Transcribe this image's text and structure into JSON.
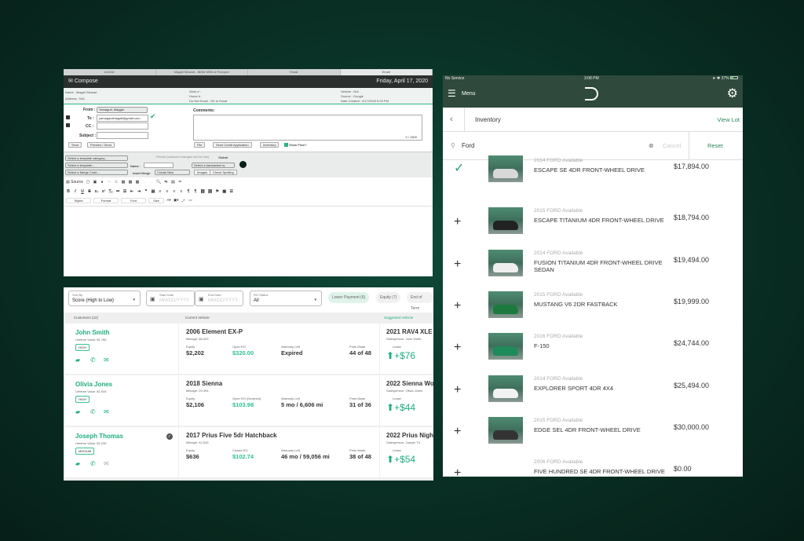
{
  "compose": {
    "tabs": [
      "eLEAD",
      "Magali Stewart - BMW MINI of Freeport",
      "Email",
      "Email"
    ],
    "title": "Compose",
    "date": "Friday, April 17, 2020",
    "info": {
      "name": "Name : Magali Stewart",
      "address": "Address : N/A",
      "work": "Work # :",
      "home": "Home # :",
      "do_not_email": "Do Not Email : OK to Email",
      "vehicle": "Vehicle : N/A",
      "source": "Source : Google",
      "date_created": "Date Created : 4/17/2020 5:29 PM"
    },
    "from_label": "From :",
    "from_value": "Yamaguti, Maggie",
    "to_label": "To :",
    "to_value": "yamagautimagali@gmail.com",
    "cc_label": "CC :",
    "subject_label": "Subject :",
    "comments_label": "Comments:",
    "char_count": "0 / 1500",
    "buttons": {
      "send": "Send",
      "preview": "Preview / Send",
      "file": "File",
      "credit": "Send Credit Application",
      "inventory": "Inventory",
      "show_price": "Show Price?"
    },
    "template": {
      "category": "Select a template category...",
      "template": "Select a template...",
      "merge": "Select a Merge Code...",
      "persist": "Persist (unsaved changes will be lost)",
      "global": "Global:",
      "name_label": "Name :",
      "transaction": "Select a transaction ty",
      "insert_merge": "Insert Merge",
      "create_new": "Create New",
      "images": "Images",
      "check_spelling": "Check Spelling"
    },
    "editor": {
      "source": "Source",
      "styles": "Styles",
      "format": "Format",
      "font": "Font",
      "size": "Size"
    }
  },
  "crm": {
    "sort_label": "Sort By",
    "sort_value": "Score (High to Low)",
    "start_label": "Start Date",
    "start_ph": "MM/DD/YYYY",
    "end_label": "End Date",
    "end_ph": "MM/DD/YYYY",
    "ro_label": "RO Status",
    "ro_value": "All",
    "chips": [
      "Lower Payment (6)",
      "Equity (7)",
      "End of Term"
    ],
    "col_customers": "Customers (22)",
    "col_vehicle": "Current Vehicle",
    "col_suggested": "Suggested Vehicle",
    "rows": [
      {
        "name": "John Smith",
        "lifetime": "Lifetime Value: $1,766",
        "badge": "HIGH",
        "vehicle": "2006 Element EX-P",
        "mileage": "Mileage: 86,023",
        "equity_label": "Equity",
        "equity": "$2,202",
        "ro_label": "Open RO",
        "ro": "$320.00",
        "warranty_label": "Warranty Left",
        "warranty": "Expired",
        "pmts_label": "Pmts Made",
        "pmts": "44 of 48",
        "suggested": "2021 RAV4 XLE",
        "salesperson": "Salesperson: John Smith",
        "lease_label": "Lease",
        "lease": "+$76"
      },
      {
        "name": "Olivia Jones",
        "lifetime": "Lifetime Value: $1,949",
        "badge": "HIGH",
        "vehicle": "2018 Sienna",
        "mileage": "Mileage: 29,394",
        "equity_label": "Equity",
        "equity": "$2,106",
        "ro_label": "Open RO (Declined)",
        "ro": "$103.98",
        "warranty_label": "Warranty Left",
        "warranty": "5 mo / 6,606 mi",
        "pmts_label": "Pmts Made",
        "pmts": "31 of 36",
        "suggested": "2022 Sienna Wo",
        "salesperson": "Salesperson: Olivia Jones",
        "lease_label": "Lease",
        "lease": "+$44"
      },
      {
        "name": "Joseph Thomas",
        "lifetime": "Lifetime Value: $2,235",
        "badge": "MEDIUM",
        "vehicle": "2017 Prius Five 5dr Hatchback",
        "mileage": "Mileage: 42,543",
        "equity_label": "Equity",
        "equity": "$636",
        "ro_label": "Closed RO",
        "ro": "$102.74",
        "warranty_label": "Warranty Left",
        "warranty": "46 mo / 59,056 mi",
        "pmts_label": "Pmts Made",
        "pmts": "38 of 48",
        "suggested": "2022 Prius Nigh",
        "salesperson": "Salesperson: Joseph Th",
        "lease_label": "Lease",
        "lease": "+$54"
      }
    ]
  },
  "ipad": {
    "status_left": "No Service",
    "time": "3:08 PM",
    "battery": "37%",
    "menu": "Menu",
    "page_title": "Inventory",
    "view_lot": "View Lot",
    "search_value": "Ford",
    "cancel": "Cancel",
    "reset": "Reset",
    "items": [
      {
        "sub": "2014 FORD Available",
        "title": "ESCAPE SE 4DR FRONT-WHEEL DRIVE",
        "price": "$17,894.00",
        "selected": true,
        "car": "#d8d8d8"
      },
      {
        "sub": "2015 FORD Available",
        "title": "ESCAPE TITANIUM 4DR FRONT-WHEEL DRIVE",
        "price": "$18,794.00",
        "selected": false,
        "car": "#222"
      },
      {
        "sub": "2014 FORD Available",
        "title": "FUSION TITANIUM 4DR FRONT-WHEEL DRIVE SEDAN",
        "price": "$19,494.00",
        "selected": false,
        "car": "#eee"
      },
      {
        "sub": "2015 FORD Available",
        "title": "MUSTANG V6 2DR FASTBACK",
        "price": "$19,999.00",
        "selected": false,
        "car": "#1d7a3e"
      },
      {
        "sub": "2016 FORD Available",
        "title": "F-150",
        "price": "$24,744.00",
        "selected": false,
        "car": "#1f8a5a"
      },
      {
        "sub": "2014 FORD Available",
        "title": "EXPLORER SPORT 4DR 4X4",
        "price": "$25,494.00",
        "selected": false,
        "car": "#f2f2f2"
      },
      {
        "sub": "2015 FORD Available",
        "title": "EDGE SEL 4DR FRONT-WHEEL DRIVE",
        "price": "$30,000.00",
        "selected": false,
        "car": "#333"
      },
      {
        "sub": "2006 FORD Available",
        "title": "FIVE HUNDRED SE 4DR FRONT-WHEEL DRIVE SEDAN",
        "price": "$0.00",
        "selected": false,
        "car": null
      }
    ]
  },
  "colors": {
    "accent": "#1fae7e",
    "ipad_header": "#2f4a3d",
    "compose_header": "#2b2f2d"
  }
}
